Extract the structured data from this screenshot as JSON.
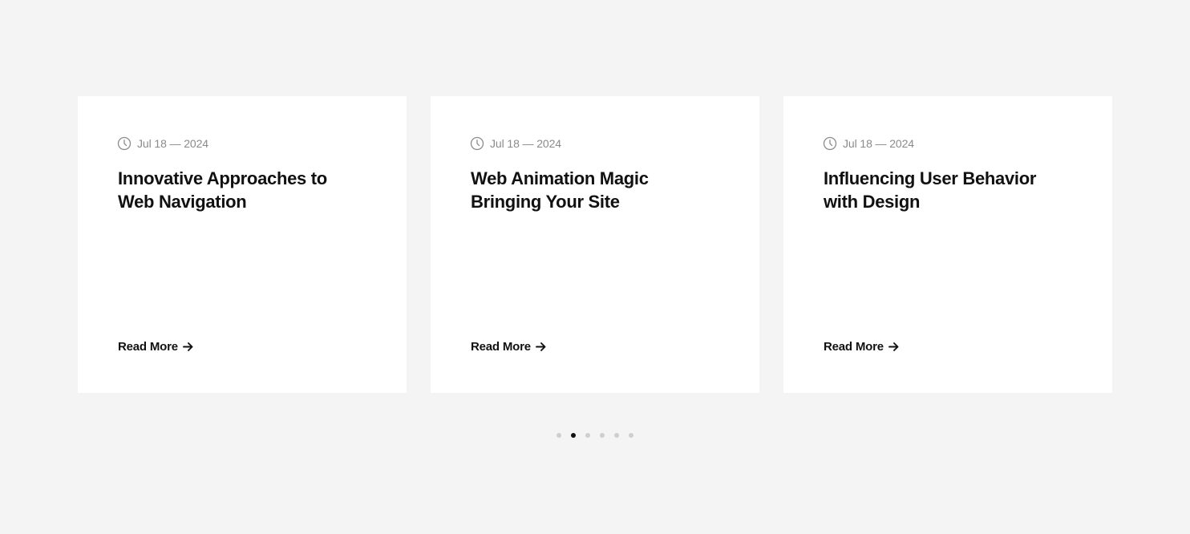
{
  "cards": [
    {
      "date": "Jul 18 — 2024",
      "title_line1": "Innovative Approaches to",
      "title_line2": "Web Navigation",
      "read_more": "Read More"
    },
    {
      "date": "Jul 18 — 2024",
      "title_line1": "Web Animation Magic",
      "title_line2": "Bringing Your Site",
      "read_more": "Read More"
    },
    {
      "date": "Jul 18 — 2024",
      "title_line1": "Influencing User Behavior",
      "title_line2": "with Design",
      "read_more": "Read More"
    }
  ],
  "pagination": {
    "total_dots": 6,
    "active_index": 1
  },
  "icons": {
    "date": "clock-icon",
    "read_more": "arrow-right-icon"
  },
  "colors": {
    "background": "#f4f4f4",
    "card": "#ffffff",
    "text": "#111111",
    "muted_text": "#8a8a8a",
    "dot_inactive": "#cfcfcf",
    "dot_active": "#111111"
  }
}
